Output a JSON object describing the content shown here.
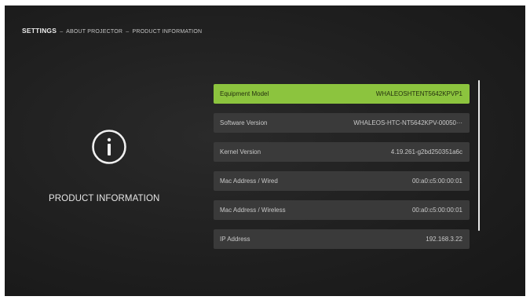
{
  "breadcrumb": {
    "root": "SETTINGS",
    "separator": "–",
    "level1": "ABOUT PROJECTOR",
    "level2": "PRODUCT INFORMATION"
  },
  "section": {
    "icon": "info-icon",
    "title": "PRODUCT INFORMATION"
  },
  "rows": [
    {
      "label": "Equipment Model",
      "value": "WHALEOSHTENT5642KPVP1",
      "selected": true
    },
    {
      "label": "Software Version",
      "value": "WHALEOS-HTC-NT5642KPV-00050···",
      "selected": false
    },
    {
      "label": "Kernel Version",
      "value": "4.19.261-g2bd250351a6c",
      "selected": false
    },
    {
      "label": "Mac Address / Wired",
      "value": "00:a0:c5:00:00:01",
      "selected": false
    },
    {
      "label": "Mac Address / Wireless",
      "value": "00:a0:c5:00:00:01",
      "selected": false
    },
    {
      "label": "IP Address",
      "value": "192.168.3.22",
      "selected": false
    }
  ],
  "colors": {
    "accent": "#8cc43e",
    "row_bg": "#3a3a3a",
    "background": "#1f1f1f"
  }
}
